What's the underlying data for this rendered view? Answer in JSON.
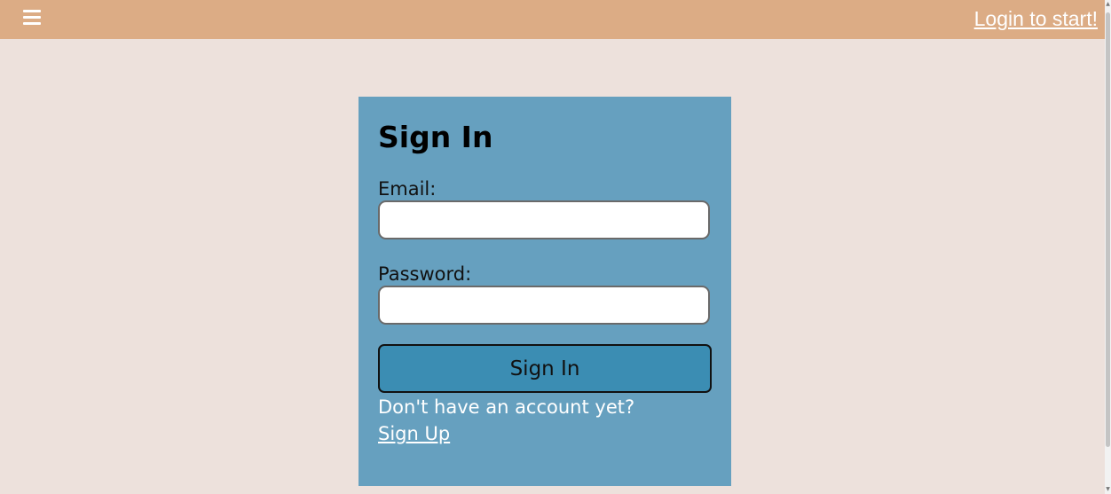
{
  "header": {
    "menu_icon": "hamburger-menu-icon",
    "login_link": "Login to start!"
  },
  "signin": {
    "title": "Sign In",
    "email_label": "Email:",
    "email_value": "",
    "password_label": "Password:",
    "password_value": "",
    "submit_label": "Sign In",
    "no_account_text": "Don't have an account yet?",
    "signup_link": "Sign Up"
  },
  "colors": {
    "header_bg": "#dcac85",
    "page_bg": "#ede1dc",
    "card_bg": "#66a0bf",
    "button_bg": "#3b8db3"
  }
}
